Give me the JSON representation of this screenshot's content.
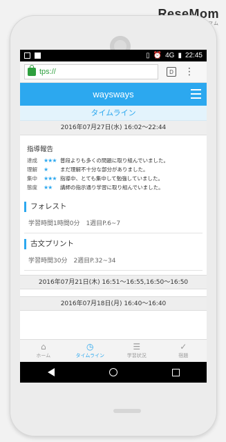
{
  "watermark": {
    "brand": "ReseMom",
    "sub": "リセマム"
  },
  "status_bar": {
    "time": "22:45",
    "signal": "4G"
  },
  "browser": {
    "url": "tps://",
    "tab_count": "D",
    "menu": "⋮"
  },
  "app": {
    "title": "waysways"
  },
  "timeline": {
    "title": "タイムライン",
    "entries": [
      {
        "date": "2016年07月27日(水) 16:02〜22:44",
        "report_title": "指導報告",
        "report_rows": [
          {
            "label": "達成",
            "stars": "★★★",
            "text": "普段よりも多くの問題に取り組んでいました。"
          },
          {
            "label": "理解",
            "stars": "★",
            "text": "まだ理解不十分な部分がありました。"
          },
          {
            "label": "集中",
            "stars": "★★★",
            "text": "指導中、とても集中して勉強していました。"
          },
          {
            "label": "態度",
            "stars": "★★",
            "text": "講師の指示通り学習に取り組んでいました。"
          }
        ],
        "subjects": [
          {
            "name": "フォレスト",
            "detail": "学習時間1時間0分　1週目P.6~7"
          },
          {
            "name": "古文プリント",
            "detail": "学習時間30分　2週目P.32~34"
          }
        ]
      },
      {
        "date": "2016年07月21日(木) 16:51〜16:55,16:50〜16:50"
      },
      {
        "date": "2016年07月18日(月) 16:40〜16:40"
      }
    ]
  },
  "bottom_nav": [
    {
      "label": "ホーム",
      "icon": "home-icon",
      "glyph": "⌂"
    },
    {
      "label": "タイムライン",
      "icon": "clock-icon",
      "glyph": "◷"
    },
    {
      "label": "学習状況",
      "icon": "list-icon",
      "glyph": "☰"
    },
    {
      "label": "宿題",
      "icon": "checklist-icon",
      "glyph": "✓"
    }
  ],
  "colors": {
    "accent": "#2ca8ef",
    "secure": "#2e9f3e"
  }
}
